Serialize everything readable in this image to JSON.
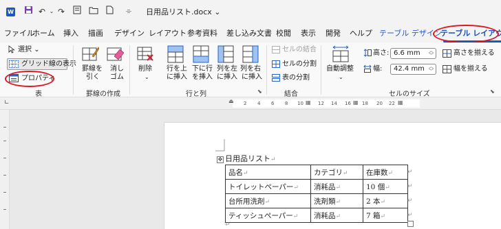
{
  "app": {
    "title": "日用品リスト.docx",
    "logo": "W",
    "title_dropdown": "⌄"
  },
  "quick_access": {
    "save_icon": "save-icon",
    "undo_glyph": "↶",
    "undo_dropdown": "⌄",
    "redo_glyph": "↷",
    "more_glyph": "⌯"
  },
  "tabs": [
    "ファイル",
    "ホーム",
    "挿入",
    "描画",
    "デザイン",
    "レイアウト",
    "参考資料",
    "差し込み文書",
    "校閲",
    "表示",
    "開発",
    "ヘルプ",
    "テーブル デザイン",
    "テーブル レイアウト"
  ],
  "ribbon": {
    "table_group": {
      "select": "選択",
      "select_dropdown": "⌄",
      "gridlines": "グリッド線の表示",
      "properties": "プロパティ",
      "name": "表"
    },
    "draw_group": {
      "draw_border_line1": "罫線を",
      "draw_border_line2": "引く",
      "eraser_line1": "消し",
      "eraser_line2": "ゴム",
      "name": "罫線の作成"
    },
    "rows_cols_group": {
      "delete": "削除",
      "delete_dropdown": "⌄",
      "insert_above_line1": "行を上",
      "insert_above_line2": "に挿入",
      "insert_below_line1": "下に行",
      "insert_below_line2": "を挿入",
      "insert_left_line1": "列を左",
      "insert_left_line2": "に挿入",
      "insert_right_line1": "列を右",
      "insert_right_line2": "に挿入",
      "name": "行と列"
    },
    "merge_group": {
      "merge_cells": "セルの結合",
      "split_cells": "セルの分割",
      "split_table": "表の分割",
      "name": "結合"
    },
    "cell_size_group": {
      "autofit": "自動調整",
      "autofit_dropdown": "⌄",
      "height_label": "高さ:",
      "height_value": "6.6 mm",
      "width_label": "幅:",
      "width_value": "42.4 mm",
      "distribute_rows": "高さを揃える",
      "distribute_cols": "幅を揃える",
      "name": "セルのサイズ"
    }
  },
  "ruler": {
    "labels": [
      "2",
      "4",
      "6",
      "8",
      "10",
      "12",
      "14",
      "16",
      "18",
      "20",
      "22"
    ]
  },
  "document": {
    "heading": "日用品リスト",
    "table": {
      "header": [
        "品名",
        "カテゴリ",
        "在庫数"
      ],
      "rows": [
        [
          "トイレットペーパー",
          "消耗品",
          "10 個"
        ],
        [
          "台所用洗剤",
          "洗剤類",
          "2 本"
        ],
        [
          "ティッシュペーパー",
          "消耗品",
          "7 箱"
        ]
      ]
    }
  },
  "colors": {
    "accent": "#185abd",
    "highlight_oval": "#e0161f",
    "contextual_tab": "#2b59c3"
  }
}
